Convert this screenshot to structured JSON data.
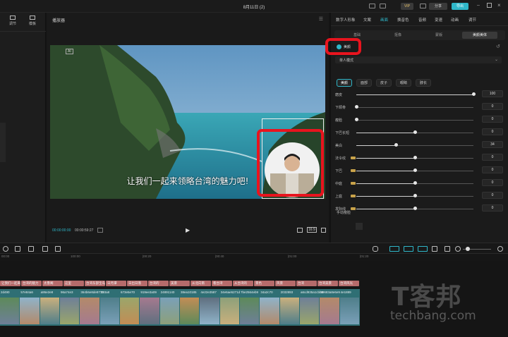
{
  "window": {
    "title": "8月11日 (2)"
  },
  "titlebar_actions": {
    "upgrade_label": "VIP",
    "share_label": "分享",
    "export_label": "导出"
  },
  "left_panel": {
    "tabs": [
      "调节",
      "模板"
    ]
  },
  "player": {
    "title": "播放器",
    "current_time": "00:00:00:00",
    "total_time": "00:00:59:27",
    "subtitle": "让我们一起来领略台湾的魅力吧!",
    "ratio_label": "16:9"
  },
  "right_panel": {
    "tabs": [
      "数字人形象",
      "文案",
      "画面",
      "换音色",
      "音频",
      "变速",
      "动画",
      "调节"
    ],
    "active_tab": "画面",
    "subtabs": [
      "基础",
      "抠像",
      "蒙版",
      "美颜美体"
    ],
    "active_subtab": "美颜美体",
    "beauty_toggle_label": "美颜",
    "mode_select": "单人模式",
    "chips": [
      "美颜",
      "面部",
      "皮子",
      "眼睛",
      "脖长"
    ],
    "sliders": [
      {
        "label": "磨皮",
        "value": 100,
        "vip": false
      },
      {
        "label": "下颌骨",
        "value": 0,
        "vip": false
      },
      {
        "label": "瘦脸",
        "value": 0,
        "vip": false
      },
      {
        "label": "下巴长短",
        "value": 0,
        "vip": false
      },
      {
        "label": "美白",
        "value": 34,
        "vip": false
      },
      {
        "label": "法令纹",
        "value": 0,
        "vip": true
      },
      {
        "label": "下巴",
        "value": 0,
        "vip": true
      },
      {
        "label": "中庭",
        "value": 0,
        "vip": true
      },
      {
        "label": "上庭",
        "value": 0,
        "vip": true
      },
      {
        "label": "发际线",
        "value": 0,
        "vip": true
      }
    ],
    "manual_label": "手动瘦脸"
  },
  "timeline": {
    "ruler": [
      "00:00",
      "100:00",
      "|00:20",
      "|00:40",
      "|01:00",
      "|01:20"
    ],
    "captions": [
      "让我们一起来",
      "台湾的魅力",
      "太鲁阁",
      "这里",
      "台湾东部宝岛",
      "日月潭",
      "日出日落",
      "台湾的",
      "美景",
      "从北向南",
      "看台湾",
      "从台湾的",
      "景色",
      "风景",
      "台湾",
      "台湾美景",
      "台湾风光"
    ],
    "clip_names": [
      "2d490",
      "57e84a6",
      "a95e2e8",
      "96a74e3",
      "364b6e8de8773",
      "293a8",
      "673e5e70",
      "919ee3a09",
      "24891140",
      "38ea10185",
      "4e22e3587",
      "34e6ae5271d",
      "7be2564eb9",
      "34a2c70",
      "2032893",
      "a6cd935a1cbb8",
      "99683a8e6e9",
      "4e1889"
    ]
  },
  "watermark": {
    "brand": "T客邦",
    "site": "techbang.com"
  },
  "colors": {
    "accent": "#2fb7c9",
    "highlight": "#e8141e",
    "caption_track": "#b66b6b",
    "video_track": "#2f6f74"
  },
  "icons": [
    "split-icon",
    "template-icon",
    "menu-icon",
    "fullscreen-icon",
    "play-icon",
    "mic-icon",
    "zoom-icon"
  ]
}
